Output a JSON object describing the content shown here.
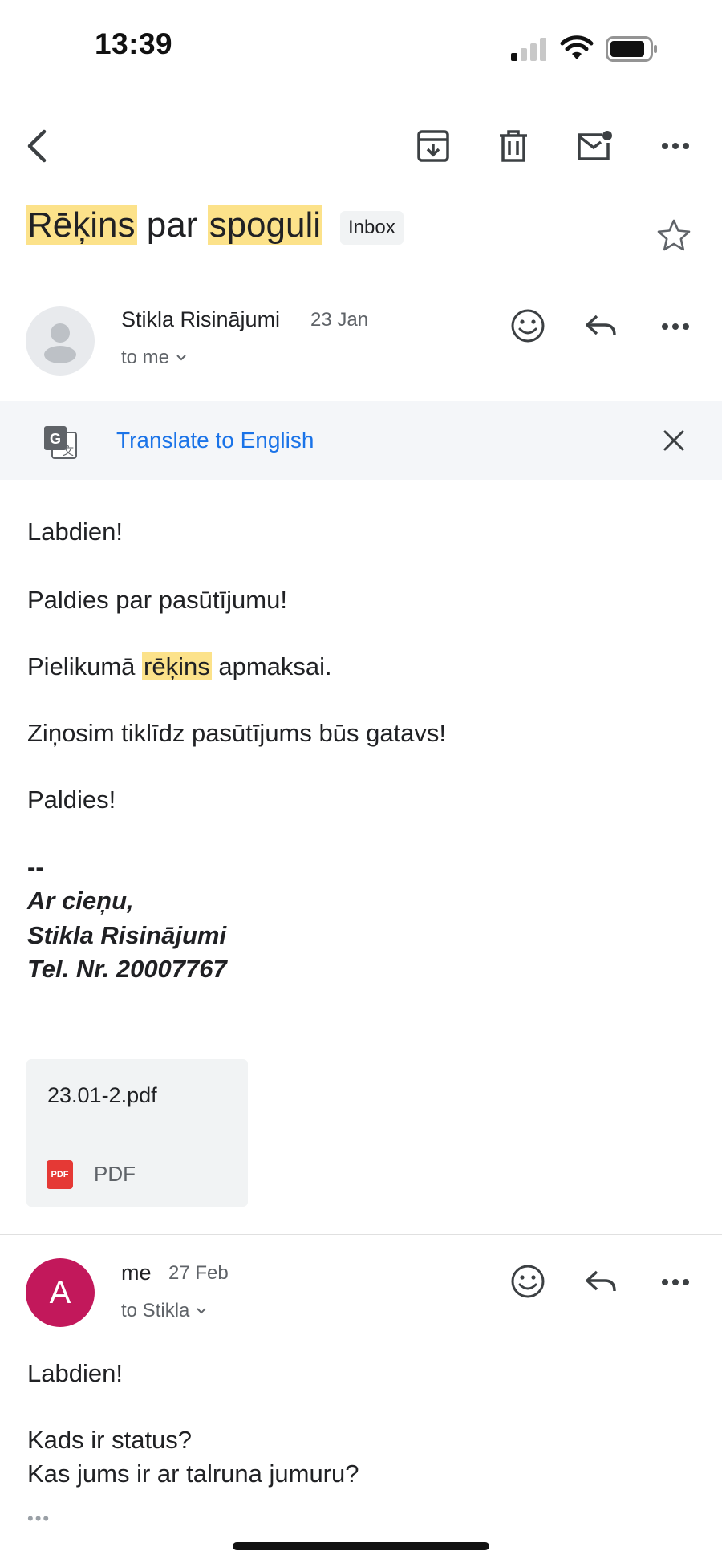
{
  "status_bar": {
    "time": "13:39"
  },
  "toolbar": {
    "back_icon": "back-arrow-icon",
    "archive_icon": "archive-icon",
    "delete_icon": "trash-icon",
    "mark_unread_icon": "mark-unread-icon",
    "more_icon": "more-horizontal-icon"
  },
  "subject": {
    "word1": "Rēķins",
    "word2": "par",
    "word3": "spoguli",
    "label": "Inbox",
    "star_icon": "star-outline-icon"
  },
  "messages": [
    {
      "sender": "Stikla Risinājumi",
      "date": "23 Jan",
      "recipients": "to me",
      "avatar_type": "default-person"
    },
    {
      "sender": "me",
      "date": "27 Feb",
      "recipients": "to Stikla",
      "avatar_letter": "A",
      "avatar_color": "#c2185b"
    }
  ],
  "translate": {
    "label": "Translate to English"
  },
  "message1_body": {
    "l1": "Labdien!",
    "l2": "Paldies par pasūtījumu!",
    "l3_pre": "Pielikumā",
    "l3_hl": "rēķins",
    "l3_post": "apmaksai.",
    "l4": "Ziņosim tiklīdz pasūtījums būs gatavs!",
    "l5": "Paldies!",
    "sig_sep": "--",
    "sig1": "Ar cieņu,",
    "sig2": "Stikla Risinājumi",
    "sig3": "Tel. Nr. 20007767"
  },
  "attachment": {
    "name": "23.01-2.pdf",
    "type": "PDF",
    "badge": "PDF"
  },
  "message2_body": {
    "l1": "Labdien!",
    "l2": "Kads ir status?",
    "l3": "Kas jums ir ar talruna jumuru?",
    "more": "•••"
  },
  "colors": {
    "highlight": "#fce28a",
    "link": "#1a73e8",
    "translate_bg": "#f4f6f9"
  }
}
